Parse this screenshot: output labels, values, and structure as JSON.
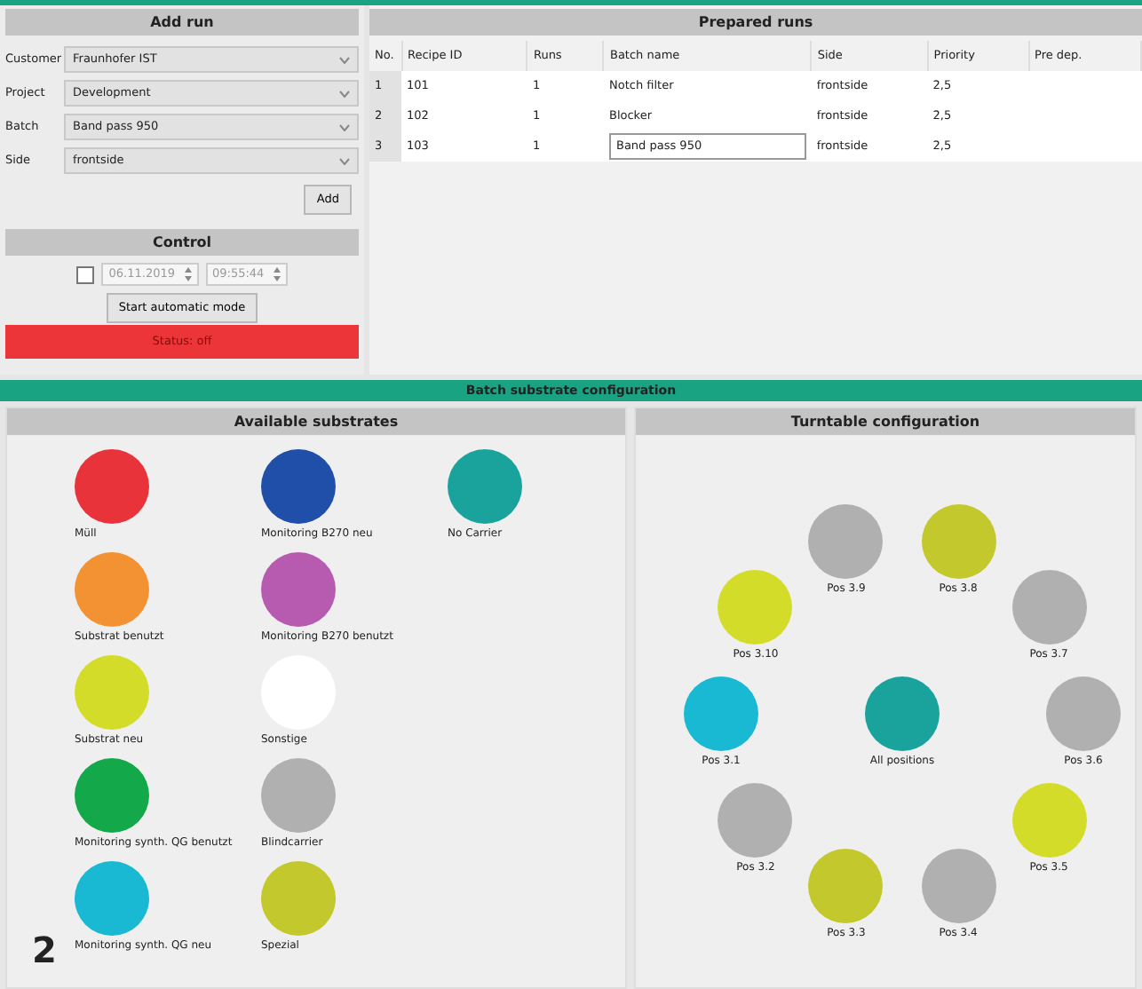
{
  "add_run": {
    "title": "Add run",
    "fields": [
      {
        "label": "Customer",
        "value": "Fraunhofer IST"
      },
      {
        "label": "Project",
        "value": "Development"
      },
      {
        "label": "Batch",
        "value": "Band pass 950"
      },
      {
        "label": "Side",
        "value": "frontside"
      }
    ],
    "add_button": "Add"
  },
  "control": {
    "title": "Control",
    "auto_start": {
      "checked": false
    },
    "date": "06.11.2019",
    "time": "09:55:44",
    "start_button": "Start automatic mode",
    "status": "Status: off"
  },
  "prepared_runs": {
    "title": "Prepared runs",
    "columns": [
      "No.",
      "Recipe ID",
      "Runs",
      "Batch name",
      "Side",
      "Priority",
      "Pre dep."
    ],
    "rows": [
      {
        "cells": [
          "1",
          "101",
          "1",
          "Notch filter",
          "frontside",
          "2,5"
        ],
        "editing": false
      },
      {
        "cells": [
          "2",
          "102",
          "1",
          "Blocker",
          "frontside",
          "2,5"
        ],
        "editing": false
      },
      {
        "cells": [
          "3",
          "103",
          "1",
          "Band pass 950",
          "frontside",
          "2,5"
        ],
        "editing": true
      }
    ]
  },
  "batch_config": {
    "title": "Batch substrate configuration",
    "available": {
      "title": "Available substrates",
      "rows": [
        [
          {
            "label": "Müll",
            "color": "#e8333a"
          },
          {
            "label": "Monitoring B270 neu",
            "color": "#1f4fa8"
          },
          {
            "label": "No Carrier",
            "color": "#1aa39c"
          }
        ],
        [
          {
            "label": "Substrat benutzt",
            "color": "#f39233"
          },
          {
            "label": "Monitoring B270 benutzt",
            "color": "#b65bb0"
          }
        ],
        [
          {
            "label": "Substrat neu",
            "color": "#d4dc2a"
          },
          {
            "label": "Sonstige",
            "color": "#ffffff"
          }
        ],
        [
          {
            "label": "Monitoring synth. QG benutzt",
            "color": "#13a84a"
          },
          {
            "label": "Blindcarrier",
            "color": "#b0b0b0"
          }
        ],
        [
          {
            "label": "Monitoring synth. QG neu",
            "color": "#1ab9d3"
          },
          {
            "label": "Spezial",
            "color": "#c3c82c"
          }
        ]
      ]
    },
    "turntable": {
      "title": "Turntable configuration",
      "center": {
        "label": "All positions",
        "color": "#1aa39c"
      },
      "positions": [
        {
          "label": "Pos 3.1",
          "color": "#1ab9d3"
        },
        {
          "label": "Pos 3.2",
          "color": "#b0b0b0"
        },
        {
          "label": "Pos 3.3",
          "color": "#c3c82c"
        },
        {
          "label": "Pos 3.4",
          "color": "#b0b0b0"
        },
        {
          "label": "Pos 3.5",
          "color": "#d4dc2a"
        },
        {
          "label": "Pos 3.6",
          "color": "#b0b0b0"
        },
        {
          "label": "Pos 3.7",
          "color": "#b0b0b0"
        },
        {
          "label": "Pos 3.8",
          "color": "#c3c82c"
        },
        {
          "label": "Pos 3.9",
          "color": "#b0b0b0"
        },
        {
          "label": "Pos 3.10",
          "color": "#d4dc2a"
        }
      ]
    }
  },
  "figure_label": "2"
}
